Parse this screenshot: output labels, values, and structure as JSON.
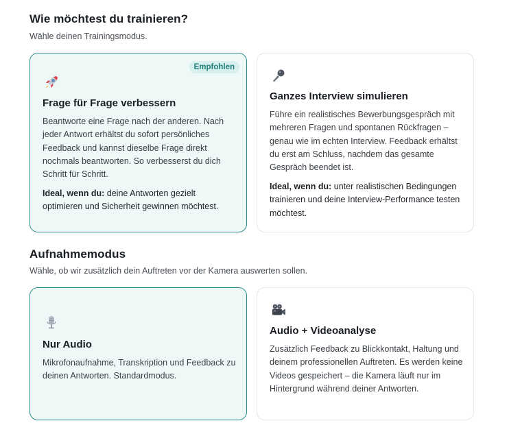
{
  "training": {
    "title": "Wie möchtest du trainieren?",
    "subtitle": "Wähle deinen Trainingsmodus.",
    "options": [
      {
        "icon": "rocket-icon",
        "badge": "Empfohlen",
        "title": "Frage für Frage verbessern",
        "description": "Beantworte eine Frage nach der anderen. Nach jeder Antwort erhältst du sofort persönliches Feedback und kannst dieselbe Frage direkt nochmals beantworten. So verbesserst du dich Schritt für Schritt.",
        "ideal_label": "Ideal, wenn du:",
        "ideal_text": " deine Antworten gezielt optimieren und Sicherheit gewinnen möchtest.",
        "selected": true
      },
      {
        "icon": "microphone-icon",
        "title": "Ganzes Interview simulieren",
        "description": "Führe ein realistisches Bewerbungsgespräch mit mehreren Fragen und spontanen Rückfragen – genau wie im echten Interview. Feedback erhältst du erst am Schluss, nachdem das gesamte Gespräch beendet ist.",
        "ideal_label": "Ideal, wenn du:",
        "ideal_text": " unter realistischen Bedingungen trainieren und deine Interview-Performance testen möchtest.",
        "selected": false
      }
    ]
  },
  "recording": {
    "title": "Aufnahmemodus",
    "subtitle": "Wähle, ob wir zusätzlich dein Auftreten vor der Kamera auswerten sollen.",
    "options": [
      {
        "icon": "studio-microphone-icon",
        "title": "Nur Audio",
        "description": "Mikrofonaufnahme, Transkription und Feedback zu deinen Antworten. Standardmodus.",
        "selected": true
      },
      {
        "icon": "movie-camera-icon",
        "title": "Audio + Videoanalyse",
        "description": "Zusätzlich Feedback zu Blickkontakt, Haltung und deinem professionellen Auftreten. Es werden keine Videos gespeichert – die Kamera läuft nur im Hintergrund während deiner Antworten.",
        "selected": false
      }
    ]
  },
  "colors": {
    "accent": "#2e8f8c",
    "selected_bg": "#eef8f7",
    "badge_bg": "#d7efed",
    "badge_text": "#217e7a"
  }
}
